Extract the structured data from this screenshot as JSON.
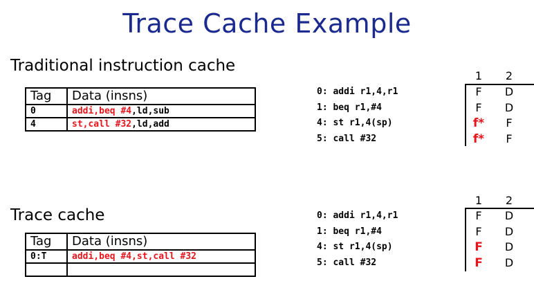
{
  "title": "Trace Cache Example",
  "sections": [
    {
      "heading": "Traditional instruction cache",
      "table": {
        "headers": [
          "Tag",
          "Data (insns)"
        ],
        "rows": [
          {
            "tag": "0",
            "data_red": "addi,beq #4",
            "data_rest": ",ld,sub"
          },
          {
            "tag": "4",
            "data_red": "st,call #32",
            "data_rest": ",ld,add"
          }
        ]
      },
      "instructions": [
        "0: addi r1,4,r1",
        "1: beq r1,#4",
        "4: st r1,4(sp)",
        "5: call #32"
      ],
      "pipeline": {
        "cycles": [
          "1",
          "2"
        ],
        "rows": [
          {
            "c1": "F",
            "c1_red": false,
            "c2": "D"
          },
          {
            "c1": "F",
            "c1_red": false,
            "c2": "D"
          },
          {
            "c1": "f*",
            "c1_red": true,
            "c2": "F"
          },
          {
            "c1": "f*",
            "c1_red": true,
            "c2": "F"
          }
        ]
      }
    },
    {
      "heading": "Trace cache",
      "table": {
        "headers": [
          "Tag",
          "Data (insns)"
        ],
        "rows": [
          {
            "tag": "0:T",
            "data_red": "addi,beq #4,st,call #32",
            "data_rest": ""
          },
          {
            "tag": "",
            "data_red": "",
            "data_rest": ""
          }
        ]
      },
      "instructions": [
        "0: addi r1,4,r1",
        "1: beq r1,#4",
        "4: st r1,4(sp)",
        "5: call #32"
      ],
      "pipeline": {
        "cycles": [
          "1",
          "2"
        ],
        "rows": [
          {
            "c1": "F",
            "c1_red": false,
            "c2": "D"
          },
          {
            "c1": "F",
            "c1_red": false,
            "c2": "D"
          },
          {
            "c1": "F",
            "c1_red": true,
            "c2": "D"
          },
          {
            "c1": "F",
            "c1_red": true,
            "c2": "D"
          }
        ]
      }
    }
  ]
}
